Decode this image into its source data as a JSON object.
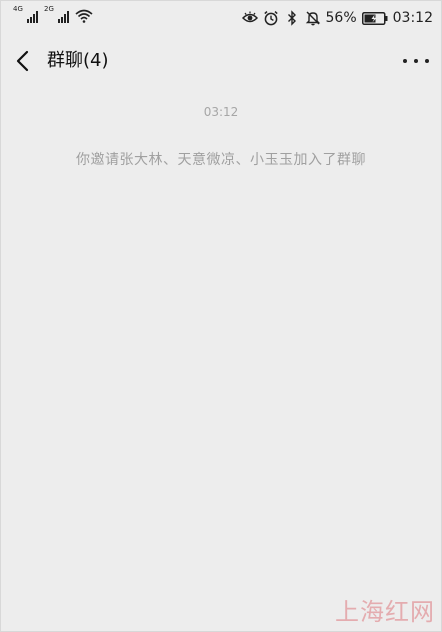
{
  "status_bar": {
    "network_1": "4G",
    "network_2": "2G",
    "battery_percent": "56%",
    "time": "03:12",
    "icons": [
      "eye-icon",
      "alarm-icon",
      "bluetooth-icon",
      "mute-bell-icon",
      "battery-charging-icon",
      "wifi-icon",
      "signal-icon"
    ]
  },
  "nav": {
    "title": "群聊(4)",
    "back_icon": "chevron-left-icon",
    "more_icon": "more-dots-icon"
  },
  "chat": {
    "timestamp": "03:12",
    "system_message": "你邀请张大林、天意微凉、小玉玉加入了群聊"
  },
  "watermark": "上海红网",
  "colors": {
    "background": "#ededed",
    "text_primary": "#111111",
    "text_muted": "#a0a0a0",
    "watermark": "#e3a1a5"
  }
}
